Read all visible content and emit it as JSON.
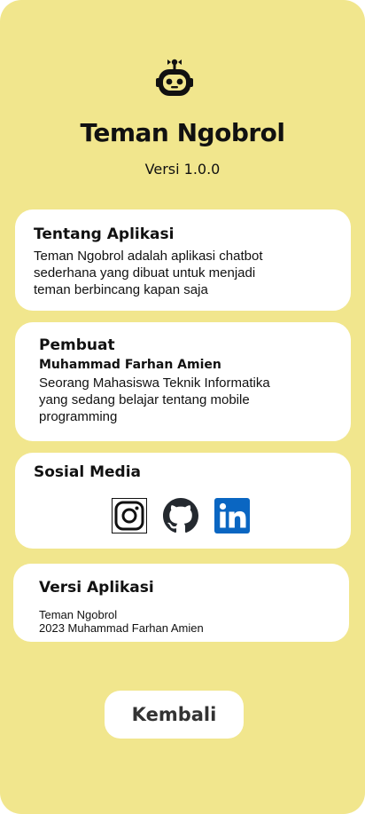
{
  "header": {
    "app_name": "Teman Ngobrol",
    "version": "Versi 1.0.0",
    "logo_icon": "robot-icon"
  },
  "about": {
    "title": "Tentang Aplikasi",
    "lines": [
      "Teman Ngobrol adalah aplikasi chatbot",
      "sederhana yang dibuat untuk menjadi",
      "teman berbincang kapan saja"
    ]
  },
  "creator": {
    "title": "Pembuat",
    "name": "Muhammad Farhan Amien",
    "lines": [
      "Seorang Mahasiswa Teknik Informatika",
      "yang sedang belajar tentang mobile",
      "programming"
    ]
  },
  "social": {
    "title": "Sosial Media",
    "icons": [
      "instagram-icon",
      "github-icon",
      "linkedin-icon"
    ]
  },
  "app_version": {
    "title": "Versi Aplikasi",
    "lines": [
      "Teman Ngobrol",
      "2023 Muhammad Farhan Amien"
    ]
  },
  "back_button": {
    "label": "Kembali"
  },
  "colors": {
    "background": "#f1e68d",
    "card": "#ffffff",
    "linkedin": "#0a66c2",
    "text": "#111111"
  }
}
